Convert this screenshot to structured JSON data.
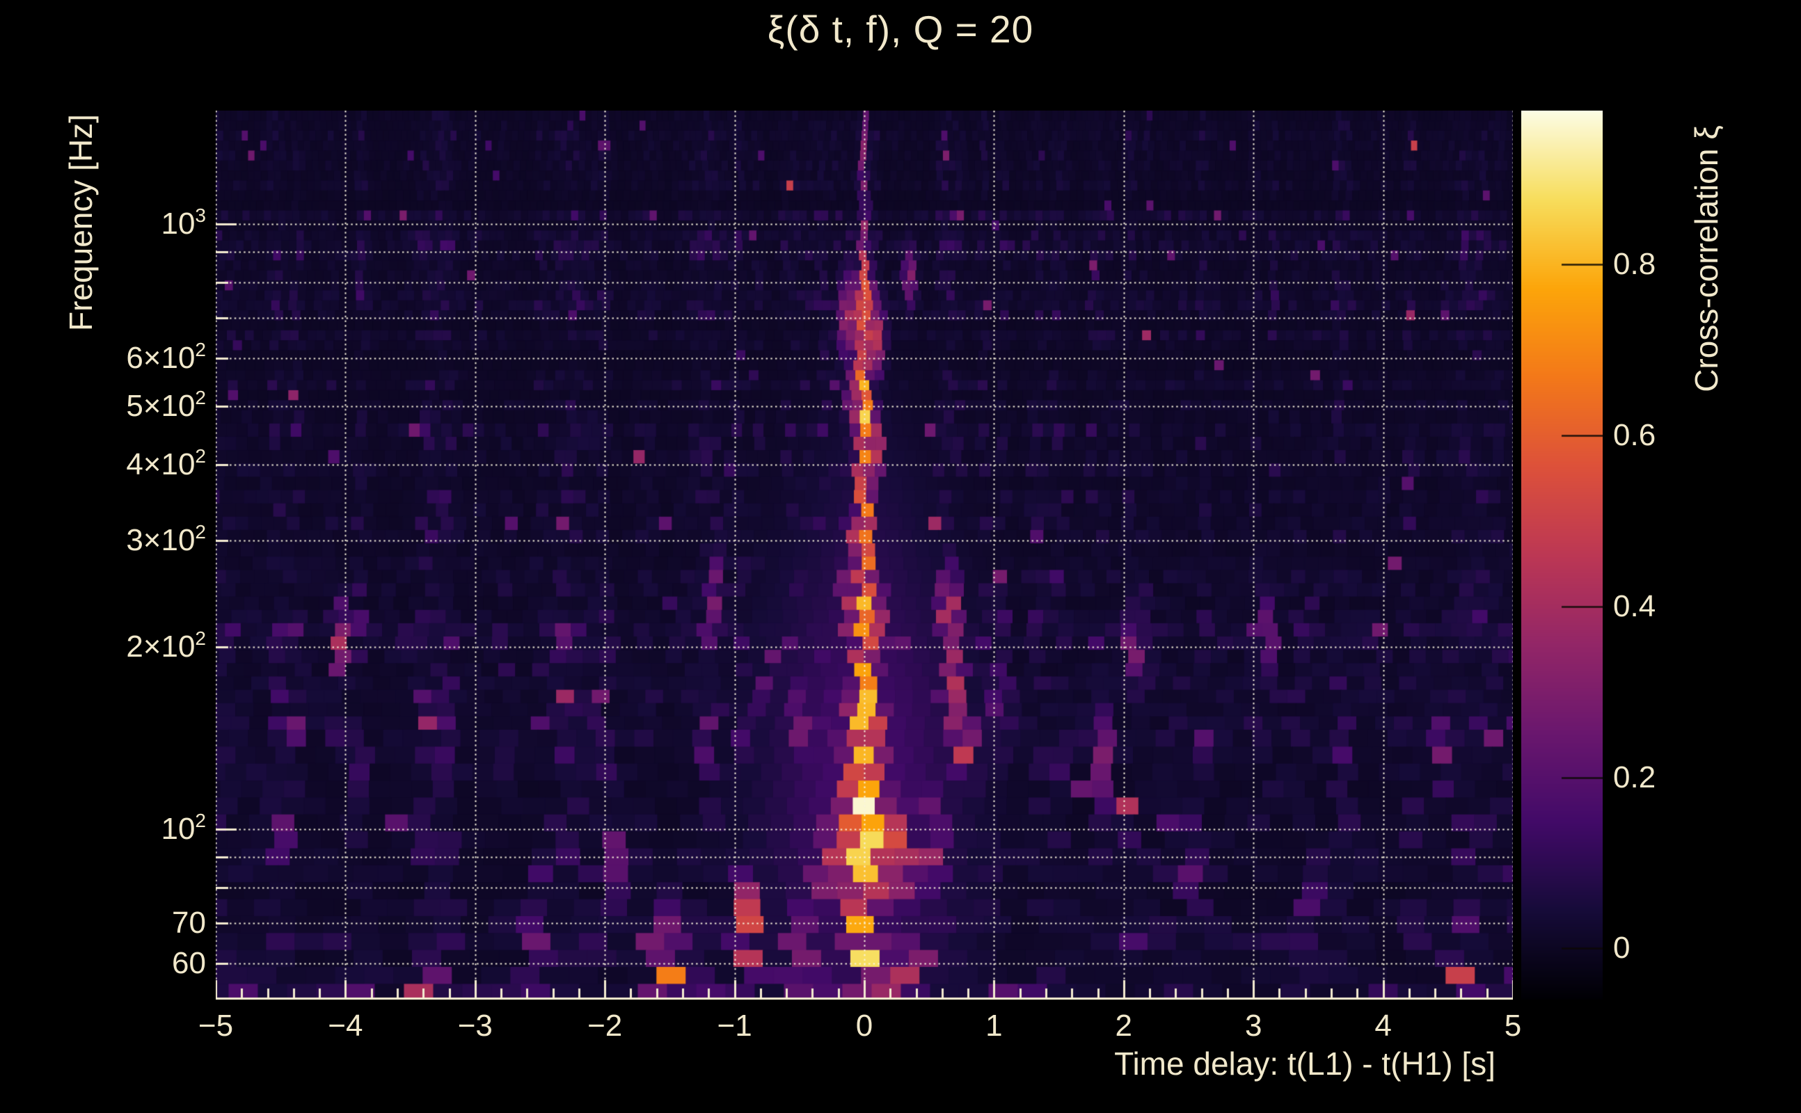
{
  "figure": {
    "title": "ξ(δ t, f), Q = 20",
    "background": "#000000",
    "text_color": "#f1e8cb",
    "grid_color": "rgba(250,244,222,0.95)"
  },
  "x_axis": {
    "label": "Time delay: t(L1) - t(H1) [s]",
    "min": -5,
    "max": 5,
    "major_tick_step": 1,
    "minor_tick_step": 0.2,
    "tick_labels": [
      {
        "value": -5,
        "label": "−5"
      },
      {
        "value": -4,
        "label": "−4"
      },
      {
        "value": -3,
        "label": "−3"
      },
      {
        "value": -2,
        "label": "−2"
      },
      {
        "value": -1,
        "label": "−1"
      },
      {
        "value": 0,
        "label": "0"
      },
      {
        "value": 1,
        "label": "1"
      },
      {
        "value": 2,
        "label": "2"
      },
      {
        "value": 3,
        "label": "3"
      },
      {
        "value": 4,
        "label": "4"
      },
      {
        "value": 5,
        "label": "5"
      }
    ]
  },
  "y_axis": {
    "label": "Frequency [Hz]",
    "scale": "log",
    "min_hz": 52.3,
    "max_hz": 1540,
    "tick_labels": [
      {
        "hz": 1000,
        "base": "10",
        "exp": "3",
        "label": "10^3"
      },
      {
        "hz": 600,
        "base": "6×10",
        "exp": "2",
        "label": "6×10^2"
      },
      {
        "hz": 500,
        "base": "5×10",
        "exp": "2",
        "label": "5×10^2"
      },
      {
        "hz": 400,
        "base": "4×10",
        "exp": "2",
        "label": "4×10^2"
      },
      {
        "hz": 300,
        "base": "3×10",
        "exp": "2",
        "label": "3×10^2"
      },
      {
        "hz": 200,
        "base": "2×10",
        "exp": "2",
        "label": "2×10^2"
      },
      {
        "hz": 100,
        "base": "10",
        "exp": "2",
        "label": "10^2"
      },
      {
        "hz": 70,
        "base": "70",
        "exp": "",
        "label": "70"
      },
      {
        "hz": 60,
        "base": "60",
        "exp": "",
        "label": "60"
      }
    ],
    "grid_hz": [
      60,
      70,
      80,
      90,
      100,
      200,
      300,
      400,
      500,
      600,
      700,
      800,
      900,
      1000
    ]
  },
  "colorbar": {
    "label": "Cross-correlation ξ",
    "colormap": "inferno",
    "vmin": -0.06,
    "vmax": 0.98,
    "tick_labels": [
      {
        "value": 0,
        "label": "0"
      },
      {
        "value": 0.2,
        "label": "0.2"
      },
      {
        "value": 0.4,
        "label": "0.4"
      },
      {
        "value": 0.6,
        "label": "0.6"
      },
      {
        "value": 0.8,
        "label": "0.8"
      }
    ]
  },
  "chart_data": {
    "type": "heatmap",
    "title": "ξ(δ t, f), Q = 20",
    "q_value": 20,
    "xlabel": "Time delay: t(L1) - t(H1) [s]",
    "ylabel": "Frequency [Hz]",
    "colorbar_label": "Cross-correlation ξ",
    "xlim": [
      -5,
      5
    ],
    "ylim_hz": [
      52.3,
      1540
    ],
    "value_range": [
      -0.06,
      0.98
    ],
    "legend_position": "right-colorbar",
    "grid": "dotted, at integer delays and at 6..9×10^1, 1..10×10^2 Hz",
    "description": "Q-transform cross-correlation ξ between LIGO L1 and H1 as a function of time delay and frequency. Dark noise floor (ξ≈0) everywhere with a bright near-white ridge at δt≈0 extending from ~55 Hz to ~1500 Hz (strongest near 60, 100, 150 and 500 Hz, chevron-shaped widening below 130 Hz), plus scattered weak hotspots.",
    "central_ridge": {
      "delay_s": 0,
      "profile_f_intensity_halfwidth": [
        [
          53,
          0.3,
          0.09
        ],
        [
          57,
          0.62,
          0.09
        ],
        [
          62,
          0.97,
          0.09
        ],
        [
          68,
          0.85,
          0.1
        ],
        [
          78,
          0.72,
          0.12
        ],
        [
          88,
          0.9,
          0.18
        ],
        [
          100,
          1.0,
          0.16
        ],
        [
          115,
          0.95,
          0.12
        ],
        [
          135,
          0.8,
          0.1
        ],
        [
          155,
          0.97,
          0.08
        ],
        [
          175,
          0.85,
          0.08
        ],
        [
          205,
          0.72,
          0.07
        ],
        [
          240,
          0.82,
          0.065
        ],
        [
          280,
          0.8,
          0.06
        ],
        [
          320,
          0.78,
          0.06
        ],
        [
          370,
          0.72,
          0.06
        ],
        [
          420,
          0.7,
          0.055
        ],
        [
          470,
          0.85,
          0.05
        ],
        [
          510,
          0.95,
          0.05
        ],
        [
          560,
          0.75,
          0.05
        ],
        [
          640,
          0.55,
          0.07
        ],
        [
          700,
          0.6,
          0.09
        ],
        [
          760,
          0.62,
          0.08
        ],
        [
          850,
          0.5,
          0.045
        ],
        [
          950,
          0.38,
          0.03
        ],
        [
          1100,
          0.32,
          0.025
        ],
        [
          1250,
          0.45,
          0.022
        ],
        [
          1500,
          0.28,
          0.022
        ]
      ]
    },
    "hotspot_format": "[delay_s, freq_hz, amplitude, width_delay_s, width_log10f]",
    "hotspots": [
      [
        0,
        115,
        0.16,
        0.55,
        0.3
      ],
      [
        0,
        75,
        0.13,
        0.45,
        0.18
      ],
      [
        0,
        190,
        0.11,
        0.4,
        0.25
      ],
      [
        0.2,
        96,
        0.62,
        0.07,
        0.05
      ],
      [
        -0.2,
        96,
        0.58,
        0.07,
        0.05
      ],
      [
        0.3,
        86,
        0.5,
        0.07,
        0.04
      ],
      [
        -0.3,
        86,
        0.45,
        0.07,
        0.04
      ],
      [
        0.13,
        120,
        0.55,
        0.05,
        0.04
      ],
      [
        -0.13,
        120,
        0.5,
        0.05,
        0.04
      ],
      [
        0.1,
        150,
        0.5,
        0.05,
        0.04
      ],
      [
        -0.1,
        150,
        0.45,
        0.05,
        0.04
      ],
      [
        0.12,
        210,
        0.5,
        0.04,
        0.045
      ],
      [
        -0.14,
        235,
        0.5,
        0.04,
        0.045
      ],
      [
        -0.1,
        300,
        0.45,
        0.035,
        0.04
      ],
      [
        0.1,
        430,
        0.5,
        0.035,
        0.04
      ],
      [
        -0.09,
        510,
        0.5,
        0.035,
        0.04
      ],
      [
        0.1,
        650,
        0.45,
        0.04,
        0.045
      ],
      [
        -0.13,
        700,
        0.42,
        0.045,
        0.05
      ],
      [
        0.35,
        820,
        0.34,
        0.035,
        0.035
      ],
      [
        -4.05,
        205,
        0.42,
        0.04,
        0.05
      ],
      [
        -2.55,
        62,
        0.3,
        0.05,
        0.05
      ],
      [
        -1.95,
        90,
        0.28,
        0.05,
        0.06
      ],
      [
        -1.5,
        56,
        0.7,
        0.05,
        0.07
      ],
      [
        -1.62,
        61,
        0.45,
        0.04,
        0.05
      ],
      [
        -1.15,
        245,
        0.3,
        0.04,
        0.05
      ],
      [
        -0.9,
        68,
        0.55,
        0.06,
        0.07
      ],
      [
        -0.5,
        62,
        0.35,
        0.08,
        0.06
      ],
      [
        -0.5,
        150,
        0.3,
        0.05,
        0.05
      ],
      [
        0.15,
        53,
        0.4,
        0.05,
        0.05
      ],
      [
        0.3,
        55,
        0.45,
        0.06,
        0.06
      ],
      [
        0.45,
        60,
        0.3,
        0.05,
        0.05
      ],
      [
        0.52,
        95,
        0.4,
        0.06,
        0.06
      ],
      [
        0.65,
        230,
        0.55,
        0.05,
        0.05
      ],
      [
        0.68,
        168,
        0.5,
        0.05,
        0.055
      ],
      [
        0.72,
        195,
        0.45,
        0.04,
        0.05
      ],
      [
        0.78,
        135,
        0.5,
        0.05,
        0.05
      ],
      [
        1.05,
        160,
        0.3,
        0.05,
        0.05
      ],
      [
        1.85,
        130,
        0.3,
        0.05,
        0.06
      ],
      [
        2.1,
        200,
        0.3,
        0.04,
        0.05
      ],
      [
        2.5,
        90,
        0.25,
        0.05,
        0.05
      ],
      [
        3.1,
        210,
        0.26,
        0.04,
        0.05
      ],
      [
        3.45,
        70,
        0.26,
        0.05,
        0.05
      ],
      [
        -3.3,
        62,
        0.28,
        0.05,
        0.05
      ],
      [
        -4.5,
        100,
        0.24,
        0.05,
        0.05
      ],
      [
        4.45,
        135,
        0.28,
        0.04,
        0.05
      ],
      [
        4.6,
        57,
        0.5,
        0.05,
        0.07
      ]
    ],
    "noise_floor": {
      "typical": 0.05,
      "max": 0.3,
      "base": 0.02,
      "amp": 0.105,
      "spike_prob": 0.013,
      "seed": 20
    }
  }
}
